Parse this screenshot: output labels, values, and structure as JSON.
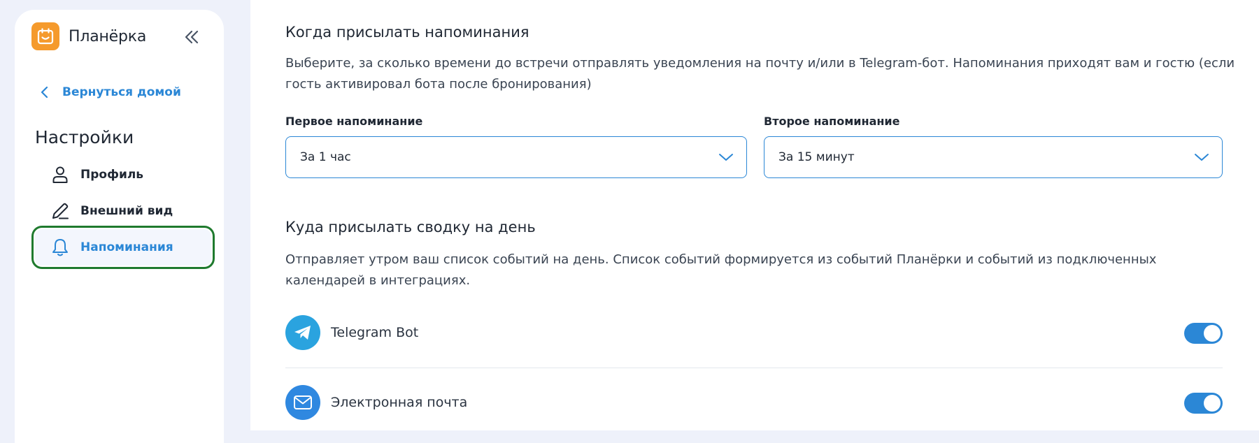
{
  "sidebar": {
    "brand_name": "Планёрка",
    "back_label": "Вернуться домой",
    "section_title": "Настройки",
    "items": [
      {
        "label": "Профиль",
        "icon": "user-icon"
      },
      {
        "label": "Внешний вид",
        "icon": "pen-icon"
      },
      {
        "label": "Напоминания",
        "icon": "bell-icon",
        "active": true
      }
    ]
  },
  "reminders": {
    "title": "Когда присылать напоминания",
    "description": "Выберите, за сколько времени до встречи отправлять уведомления на почту и/или в Telegram-бот. Напоминания приходят вам и гостю (если гость активировал бота после бронирования)",
    "first": {
      "label": "Первое напоминание",
      "value": "За 1 час"
    },
    "second": {
      "label": "Второе напоминание",
      "value": "За 15 минут"
    }
  },
  "digest": {
    "title": "Куда присылать сводку на день",
    "description": "Отправляет утром ваш список событий на день. Список событий формируется из событий Планёрки и событий из подключенных календарей в интеграциях.",
    "channels": [
      {
        "label": "Telegram Bot",
        "icon": "telegram-icon",
        "enabled": true
      },
      {
        "label": "Электронная почта",
        "icon": "mail-icon",
        "enabled": true
      }
    ]
  },
  "colors": {
    "accent": "#2b87d6",
    "brand": "#f59a2c",
    "active_outline": "#1f7a2e",
    "background": "#eef1fa"
  }
}
